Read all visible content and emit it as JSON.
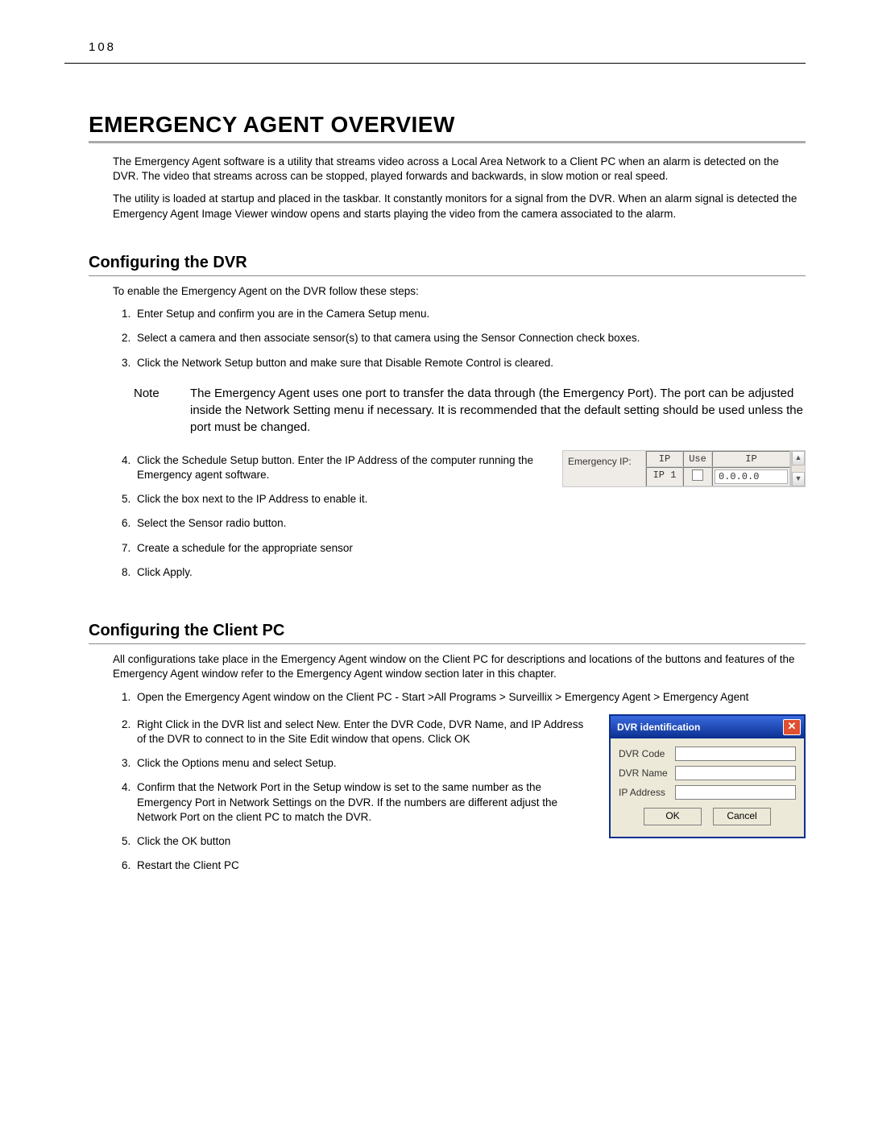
{
  "page_number": "108",
  "h1": "Emergency Agent Overview",
  "intro": [
    "The Emergency Agent software is a utility that streams video across a Local Area Network to a Client PC when an alarm is detected on the DVR. The video that streams across can be stopped, played forwards and backwards, in slow motion or real speed.",
    "The utility is loaded at startup and placed in the taskbar. It constantly monitors for a signal from the DVR. When an alarm signal is detected the Emergency Agent Image Viewer window opens and starts playing the video from the camera associated to the alarm."
  ],
  "section_dvr": {
    "heading": "Configuring the DVR",
    "lead": "To enable the Emergency Agent on the DVR follow these steps:",
    "steps_a": [
      "Enter Setup and confirm you are in the Camera Setup menu.",
      "Select a camera and then associate sensor(s) to that camera using the Sensor Connection check boxes.",
      "Click the Network Setup button and make sure that Disable Remote Control is cleared."
    ],
    "note_label": "Note",
    "note_body": "The Emergency Agent uses one port to transfer the data through (the Emergency Port). The port can be adjusted inside the Network Setting menu if necessary. It is recommended that the default setting should be used unless the port must be changed.",
    "steps_b": [
      "Click the Schedule Setup button.  Enter the IP Address of the computer running the Emergency agent software.",
      "Click the box next to the IP Address to enable it.",
      "Select the Sensor radio button.",
      "Create a schedule for the appropriate sensor",
      "Click Apply."
    ],
    "eip": {
      "label": "Emergency IP:",
      "col_ip": "IP",
      "col_use": "Use",
      "col_ip2": "IP",
      "row_ip": "IP 1",
      "row_val": "0.0.0.0"
    }
  },
  "section_pc": {
    "heading": "Configuring the Client PC",
    "lead": "All configurations take place in the Emergency Agent window on the Client PC for descriptions and locations of the buttons and features of the Emergency Agent window refer to the Emergency Agent window section later in this chapter.",
    "steps_a": [
      "Open the Emergency Agent window on the Client PC - Start >All Programs > Surveillix > Emergency Agent > Emergency Agent"
    ],
    "steps_b": [
      "Right Click in the DVR list and select New.  Enter the DVR Code, DVR Name, and IP Address of the DVR to connect to in the Site Edit window that opens. Click OK",
      "Click the Options menu and select Setup.",
      "Confirm that the Network Port in the Setup window is set to the same number as the Emergency Port in Network Settings on the DVR. If the numbers are different adjust the Network Port on the client PC to match the DVR.",
      "Click the OK button",
      "Restart the Client PC"
    ],
    "dlg": {
      "title": "DVR identification",
      "f1": "DVR Code",
      "f2": "DVR Name",
      "f3": "IP Address",
      "ok": "OK",
      "cancel": "Cancel"
    }
  }
}
